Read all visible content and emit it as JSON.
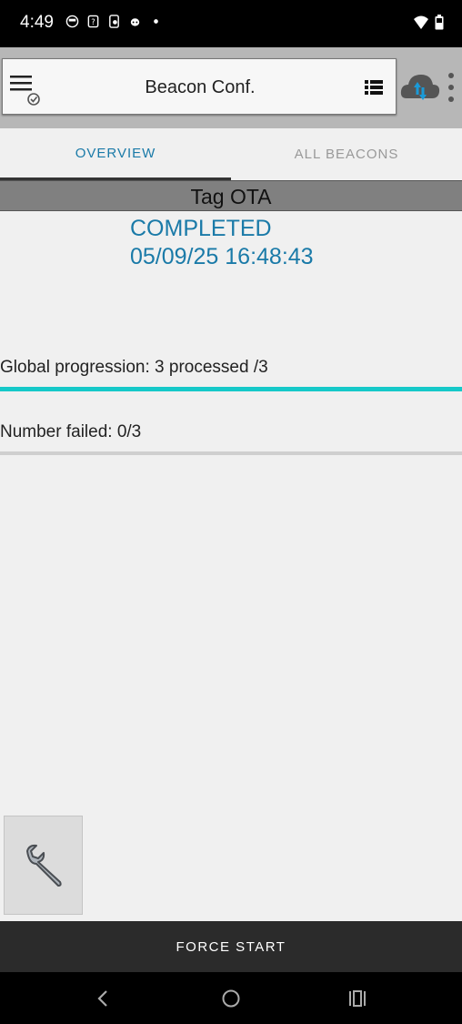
{
  "status_bar": {
    "time": "4:49",
    "icons": [
      "notification-icon",
      "sim-icon",
      "phone-icon",
      "face-icon",
      "dot-icon"
    ],
    "right_icons": [
      "wifi-icon",
      "battery-icon"
    ]
  },
  "toolbar": {
    "title": "Beacon Conf.",
    "menu_icon": "menu-sync-icon",
    "list_icon": "list-icon",
    "cloud_icon": "cloud-sync-icon",
    "more_icon": "more-vert-icon"
  },
  "tabs": [
    {
      "label": "OVERVIEW",
      "selected": true
    },
    {
      "label": "ALL BEACONS",
      "selected": false
    }
  ],
  "section": {
    "title": "Tag OTA",
    "status": "COMPLETED",
    "timestamp": "05/09/25 16:48:43"
  },
  "progress": {
    "label": "Global progression: 3 processed /3",
    "fraction": 1.0
  },
  "failed": {
    "label": "Number failed: 0/3",
    "fraction": 0.0
  },
  "tool_button": {
    "icon": "wrench-icon"
  },
  "action": {
    "force_start": "FORCE START"
  },
  "nav": [
    "back-icon",
    "home-icon",
    "recents-icon"
  ],
  "colors": {
    "accent": "#1a7aa8",
    "progress": "#16c9c9",
    "header_bg": "#808080",
    "action_bg": "#2b2b2b"
  }
}
